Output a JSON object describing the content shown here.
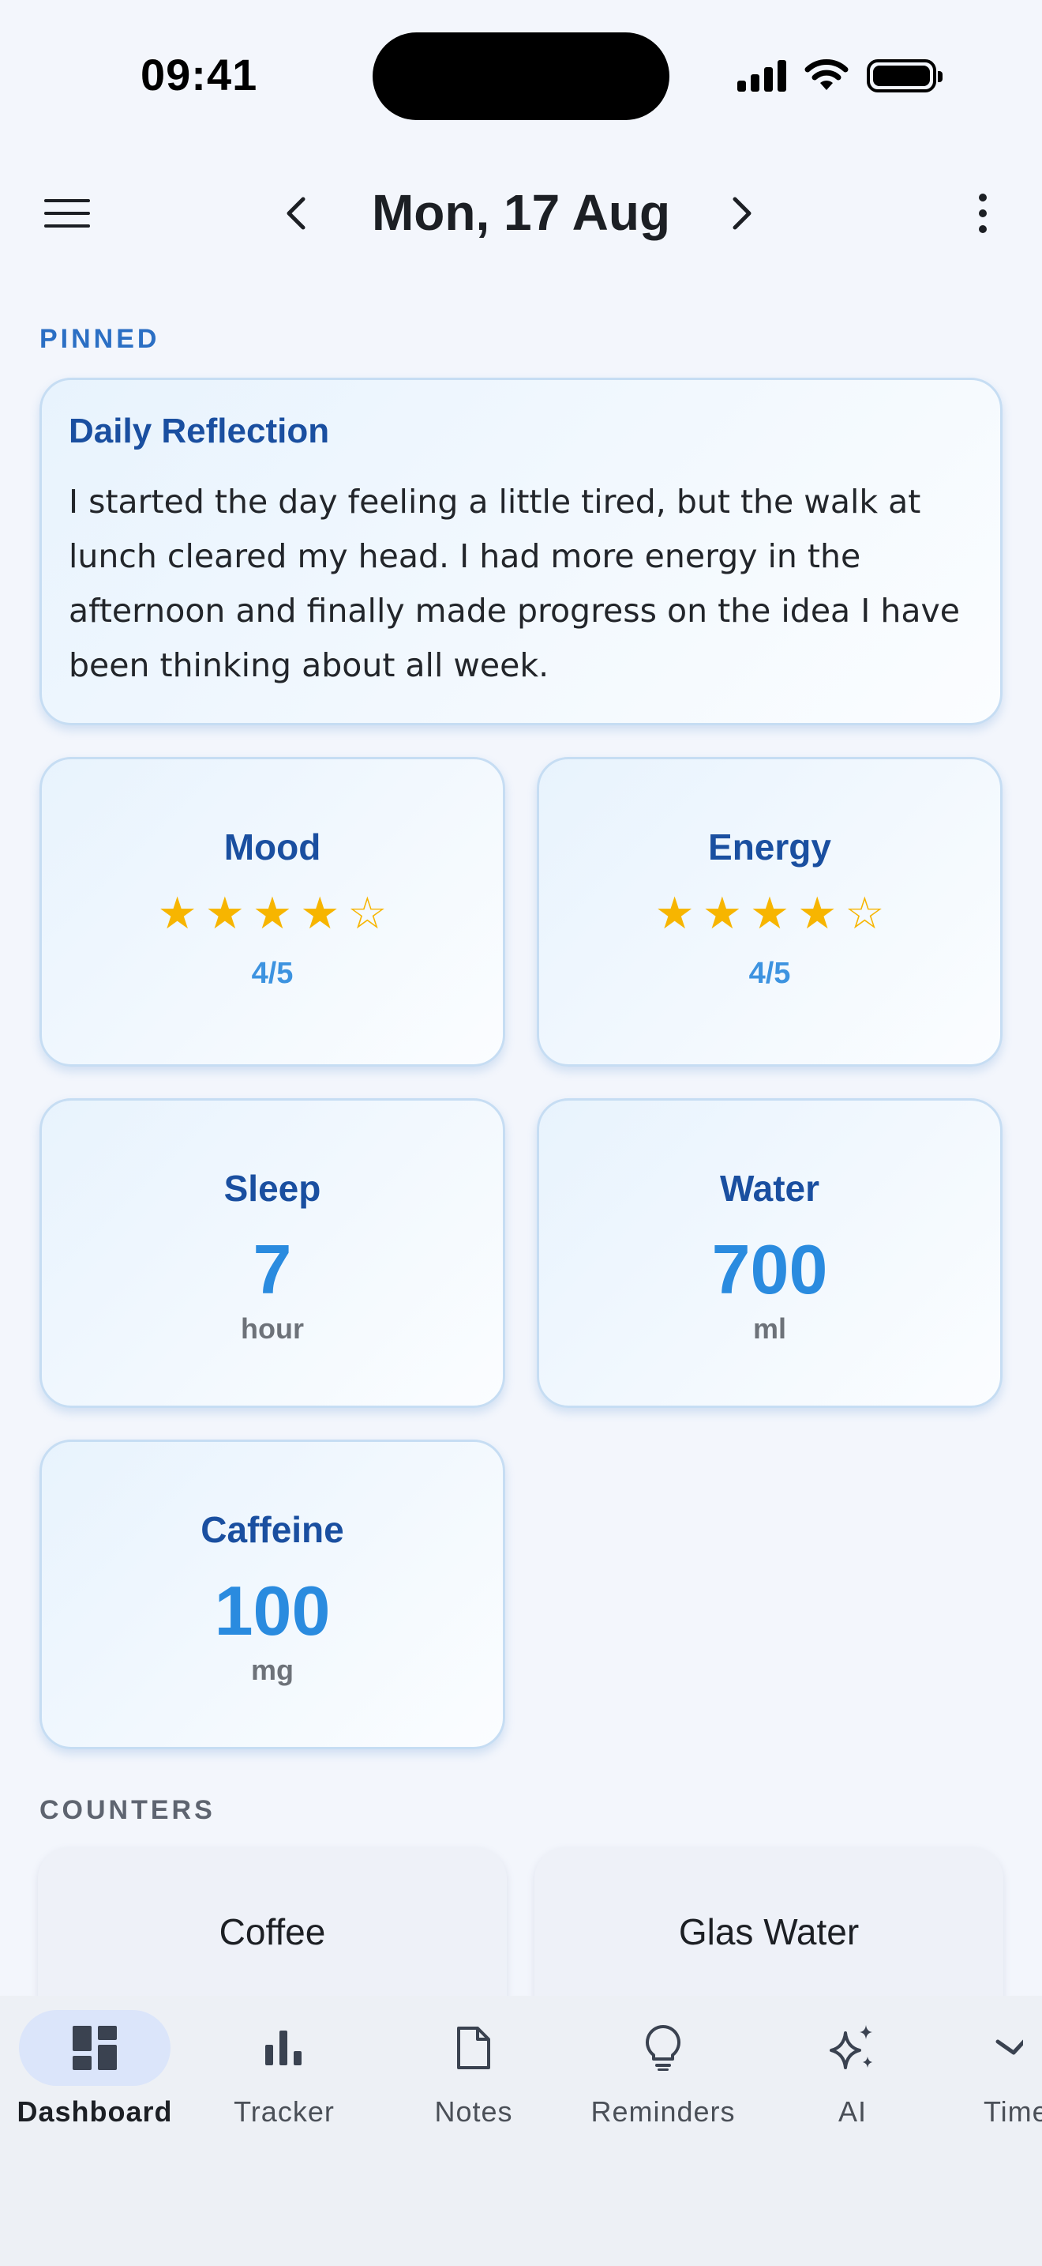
{
  "status_bar": {
    "time": "09:41"
  },
  "app_bar": {
    "date": "Mon, 17 Aug"
  },
  "pinned": {
    "label": "PINNED",
    "reflection": {
      "title": "Daily Reflection",
      "text": "I started the day feeling a little tired, but the walk at lunch cleared my head. I had more energy in the afternoon and finally made progress on the idea I have been thinking about all week."
    }
  },
  "metrics": {
    "mood": {
      "title": "Mood",
      "rating": 4,
      "max": 5,
      "rating_text": "4/5"
    },
    "energy": {
      "title": "Energy",
      "rating": 4,
      "max": 5,
      "rating_text": "4/5"
    },
    "sleep": {
      "title": "Sleep",
      "value": "7",
      "unit": "hour"
    },
    "water": {
      "title": "Water",
      "value": "700",
      "unit": "ml"
    },
    "caffeine": {
      "title": "Caffeine",
      "value": "100",
      "unit": "mg"
    }
  },
  "counters": {
    "label": "COUNTERS",
    "items": [
      {
        "title": "Coffee"
      },
      {
        "title": "Glas Water"
      }
    ]
  },
  "nav": {
    "items": [
      {
        "label": "Dashboard",
        "icon": "dashboard-icon",
        "active": true
      },
      {
        "label": "Tracker",
        "icon": "bar-chart-icon"
      },
      {
        "label": "Notes",
        "icon": "note-icon"
      },
      {
        "label": "Reminders",
        "icon": "lightbulb-icon"
      },
      {
        "label": "AI",
        "icon": "sparkles-icon"
      },
      {
        "label": "Time",
        "icon": "timeline-icon"
      }
    ]
  },
  "colors": {
    "accent": "#2a8bdf",
    "title_blue": "#1a4fa0",
    "star": "#f7b500",
    "nav_active": "#dbe5fa"
  }
}
